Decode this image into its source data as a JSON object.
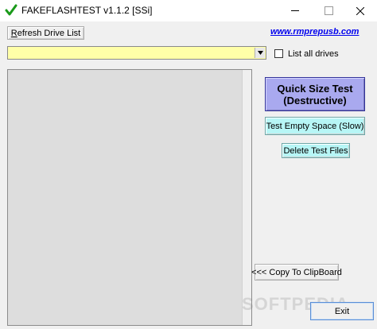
{
  "window": {
    "title": "FAKEFLASHTEST v1.1.2  [SSi]",
    "icon": "green-checkmark-icon"
  },
  "toolbar": {
    "refresh_label": "Refresh Drive List",
    "refresh_access": "R",
    "refresh_rest": "efresh Drive List",
    "website": "www.rmprepusb.com"
  },
  "drive_select": {
    "value": "",
    "background": "#ffffa8"
  },
  "list_all": {
    "label": "List all drives",
    "checked": false
  },
  "actions": {
    "quick_line1": "Quick Size Test",
    "quick_line2": "(Destructive)",
    "empty_space": "Test Empty Space (Slow)",
    "delete_files": "Delete Test Files",
    "copy_clipboard": "<<< Copy To ClipBoard",
    "exit": "Exit"
  },
  "watermark": "SOFTPEDIA",
  "colors": {
    "quick_bg": "#a9a9ef",
    "cyan_bg": "#b7f6f6",
    "link": "#0000ee"
  }
}
